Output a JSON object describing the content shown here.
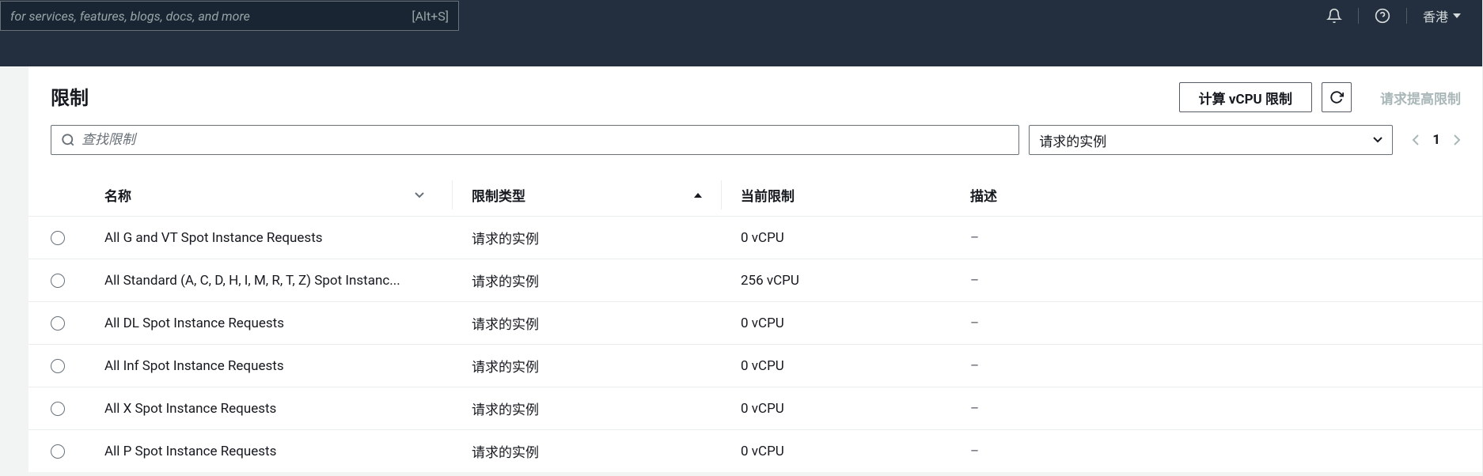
{
  "nav": {
    "search_placeholder": "for services, features, blogs, docs, and more",
    "search_shortcut": "[Alt+S]",
    "region": "香港"
  },
  "panel": {
    "title": "限制",
    "compute_button": "计算 vCPU 限制",
    "request_increase": "请求提高限制"
  },
  "filters": {
    "search_placeholder": "查找限制",
    "dropdown_value": "请求的实例",
    "page": "1"
  },
  "table": {
    "columns": {
      "name": "名称",
      "type": "限制类型",
      "current": "当前限制",
      "description": "描述"
    },
    "rows": [
      {
        "name": "All G and VT Spot Instance Requests",
        "type": "请求的实例",
        "limit": "0 vCPU",
        "desc": "–"
      },
      {
        "name": "All Standard (A, C, D, H, I, M, R, T, Z) Spot Instanc...",
        "type": "请求的实例",
        "limit": "256 vCPU",
        "desc": "–"
      },
      {
        "name": "All DL Spot Instance Requests",
        "type": "请求的实例",
        "limit": "0 vCPU",
        "desc": "–"
      },
      {
        "name": "All Inf Spot Instance Requests",
        "type": "请求的实例",
        "limit": "0 vCPU",
        "desc": "–"
      },
      {
        "name": "All X Spot Instance Requests",
        "type": "请求的实例",
        "limit": "0 vCPU",
        "desc": "–"
      },
      {
        "name": "All P Spot Instance Requests",
        "type": "请求的实例",
        "limit": "0 vCPU",
        "desc": "–"
      }
    ]
  }
}
